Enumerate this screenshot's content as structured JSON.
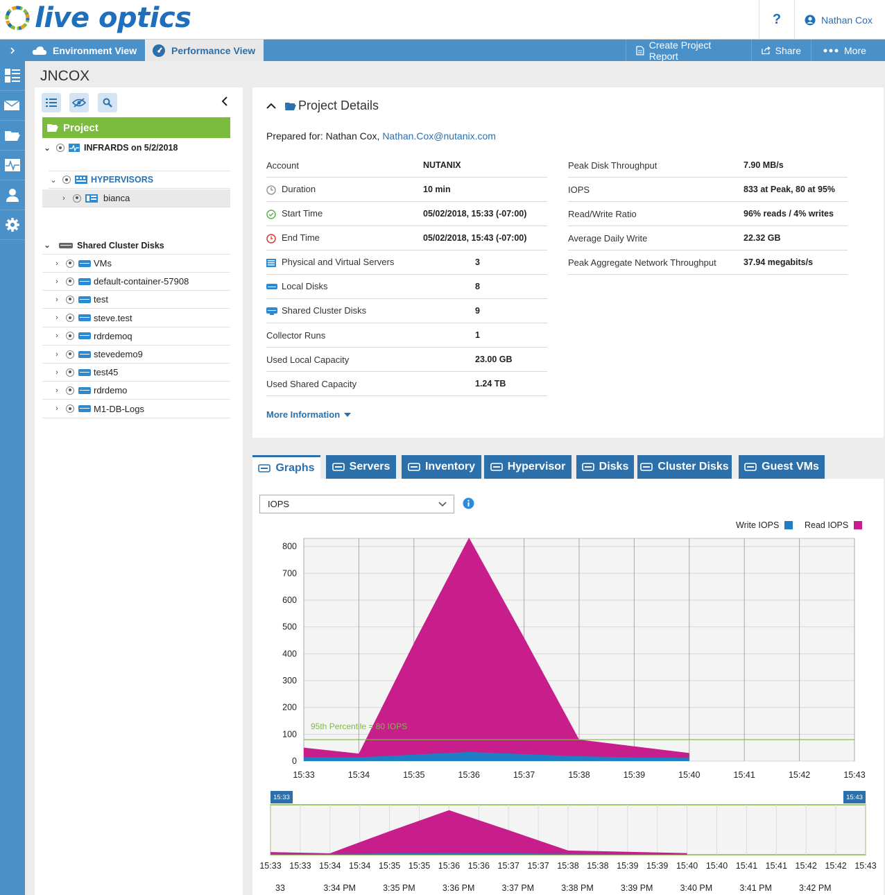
{
  "app": {
    "logo_text": "live optics",
    "help": "?",
    "user": "Nathan Cox"
  },
  "nav": {
    "tabs": [
      {
        "label": "Environment View"
      },
      {
        "label": "Performance View"
      }
    ],
    "actions": {
      "report": "Create Project Report",
      "share": "Share",
      "more": "More"
    }
  },
  "page": {
    "title": "JNCOX"
  },
  "tree": {
    "project_label": "Project",
    "run": "INFRARDS on 5/2/2018",
    "hypervisors": "HYPERVISORS",
    "host": "bianca",
    "shared_header": "Shared Cluster Disks",
    "shared_items": [
      "VMs",
      "default-container-57908",
      "test",
      "steve.test",
      "rdrdemoq",
      "stevedemo9",
      "test45",
      "rdrdemo",
      "M1-DB-Logs"
    ]
  },
  "details": {
    "header": "Project Details",
    "prepared_label": "Prepared for: Nathan Cox,",
    "email": "Nathan.Cox@nutanix.com",
    "left": [
      {
        "label": "Account",
        "value": "NUTANIX",
        "icon": "none"
      },
      {
        "label": "Duration",
        "value": "10 min",
        "icon": "clock-icon"
      },
      {
        "label": "Start Time",
        "value": "05/02/2018, 15:33 (-07:00)",
        "icon": "start-check-icon"
      },
      {
        "label": "End Time",
        "value": "05/02/2018, 15:43 (-07:00)",
        "icon": "end-clock-icon"
      },
      {
        "label": "Physical and Virtual Servers",
        "value": "3",
        "icon": "server-icon"
      },
      {
        "label": "Local Disks",
        "value": "8",
        "icon": "disk-icon"
      },
      {
        "label": "Shared Cluster Disks",
        "value": "9",
        "icon": "shared-disk-icon"
      },
      {
        "label": "Collector Runs",
        "value": "1",
        "icon": "none"
      },
      {
        "label": "Used Local Capacity",
        "value": "23.00 GB",
        "icon": "none"
      },
      {
        "label": "Used Shared Capacity",
        "value": "1.24 TB",
        "icon": "none"
      }
    ],
    "right": [
      {
        "label": "Peak Disk Throughput",
        "value": "7.90 MB/s"
      },
      {
        "label": "IOPS",
        "value": "833 at Peak, 80 at 95%"
      },
      {
        "label": "Read/Write Ratio",
        "value": "96% reads / 4% writes"
      },
      {
        "label": "Average Daily Write",
        "value": "22.32 GB"
      },
      {
        "label": "Peak Aggregate Network Throughput",
        "value": "37.94 megabits/s"
      }
    ],
    "more_info": "More Information"
  },
  "graph_tabs": [
    {
      "label": "Graphs"
    },
    {
      "label": "Servers"
    },
    {
      "label": "Inventory"
    },
    {
      "label": "Hypervisor"
    },
    {
      "label": "Disks"
    },
    {
      "label": "Cluster Disks"
    },
    {
      "label": "Guest VMs"
    }
  ],
  "graph": {
    "select_value": "IOPS",
    "legend": {
      "write": "Write IOPS",
      "read": "Read IOPS"
    },
    "colors": {
      "write": "#1f7fc4",
      "read": "#c81e8c",
      "percentile": "#7bbb3e"
    },
    "percentile_label": "95th Percentile = 80 IOPS"
  },
  "chart_data": [
    {
      "type": "area",
      "x": [
        "15:33",
        "15:34",
        "15:35",
        "15:36",
        "15:37",
        "15:38",
        "15:39",
        "15:40"
      ],
      "x_ticks": [
        "15:33",
        "15:34",
        "15:35",
        "15:36",
        "15:37",
        "15:38",
        "15:39",
        "15:40",
        "15:41",
        "15:42",
        "15:43"
      ],
      "y_ticks": [
        "0",
        "100",
        "200",
        "300",
        "400",
        "500",
        "600",
        "700",
        "800"
      ],
      "ylim": [
        0,
        830
      ],
      "series": [
        {
          "name": "Write IOPS",
          "values": [
            15,
            14,
            24,
            34,
            26,
            18,
            14,
            12
          ]
        },
        {
          "name": "Read IOPS",
          "values": [
            50,
            28,
            440,
            833,
            460,
            80,
            55,
            30
          ]
        }
      ],
      "reference_line": {
        "value": 80,
        "label": "95th Percentile = 80 IOPS"
      },
      "grid": true,
      "legend": "top-right"
    },
    {
      "type": "area",
      "role": "navigator",
      "range": [
        "15:33",
        "15:43"
      ],
      "tick_labels": [
        "15:33",
        "15:33",
        "15:34",
        "15:34",
        "15:35",
        "15:35",
        "15:36",
        "15:36",
        "15:37",
        "15:37",
        "15:38",
        "15:38",
        "15:39",
        "15:39",
        "15:40",
        "15:40",
        "15:41",
        "15:41",
        "15:42",
        "15:42",
        "15:43"
      ],
      "bottom_labels": [
        "33",
        "3:34 PM",
        "3:35 PM",
        "3:36 PM",
        "3:37 PM",
        "3:38 PM",
        "3:39 PM",
        "3:40 PM",
        "3:41 PM",
        "3:42 PM"
      ]
    }
  ]
}
